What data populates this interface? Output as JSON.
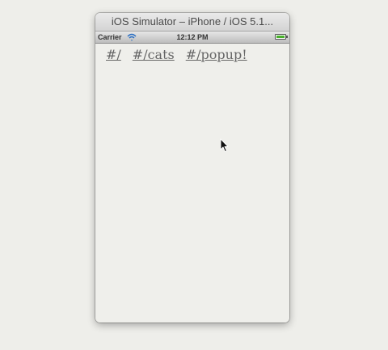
{
  "window": {
    "title": "iOS Simulator – iPhone / iOS 5.1..."
  },
  "statusbar": {
    "carrier": "Carrier",
    "time": "12:12 PM",
    "battery_level": 1.0,
    "battery_color": "#48b02c"
  },
  "nav": {
    "links": [
      {
        "label": "#/"
      },
      {
        "label": "#/cats"
      },
      {
        "label": "#/popup!"
      }
    ]
  },
  "icons": {
    "wifi": "wifi-icon",
    "battery": "battery-icon",
    "cursor": "mouse-pointer-icon"
  }
}
